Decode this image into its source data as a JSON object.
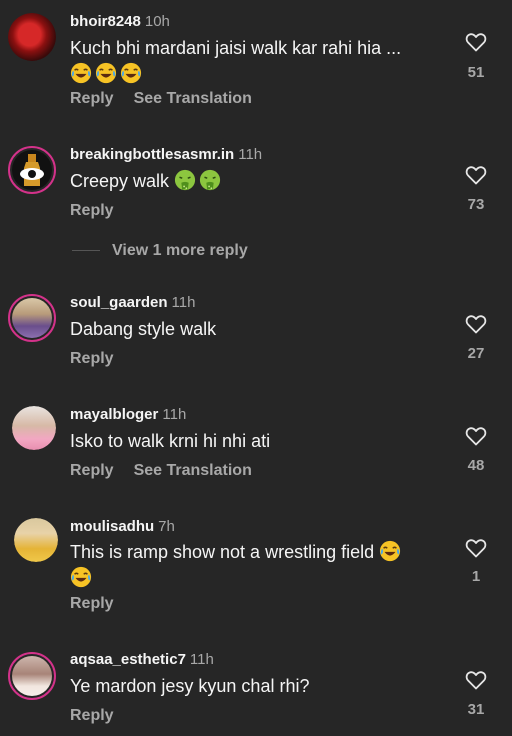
{
  "comments": [
    {
      "username": "bhoir8248",
      "time": "10h",
      "text": "Kuch bhi mardani jaisi walk kar rahi hia ...",
      "reply": "Reply",
      "translate": "See Translation",
      "likes": "51"
    },
    {
      "username": "breakingbottlesasmr.in",
      "time": "11h",
      "text": "Creepy walk",
      "reply": "Reply",
      "likes": "73"
    },
    {
      "username": "soul_gaarden",
      "time": "11h",
      "text": "Dabang style walk",
      "reply": "Reply",
      "likes": "27"
    },
    {
      "username": "mayalbloger",
      "time": "11h",
      "text": "Isko to walk krni hi nhi ati",
      "reply": "Reply",
      "translate": "See Translation",
      "likes": "48"
    },
    {
      "username": "moulisadhu",
      "time": "7h",
      "text": "This is ramp show not a wrestling field",
      "reply": "Reply",
      "likes": "1"
    },
    {
      "username": "aqsaa_esthetic7",
      "time": "11h",
      "text": "Ye mardon jesy kyun chal rhi?",
      "reply": "Reply",
      "likes": "31"
    }
  ],
  "more_replies": "View 1 more reply",
  "icons": {
    "like": "heart-outline-icon",
    "laugh": "face-with-tears-of-joy-icon",
    "vomit": "face-vomiting-icon"
  },
  "colors": {
    "background": "#262626",
    "text": "#f5f5f5",
    "muted": "#a8a8a8",
    "story_ring": "#d3328a"
  }
}
